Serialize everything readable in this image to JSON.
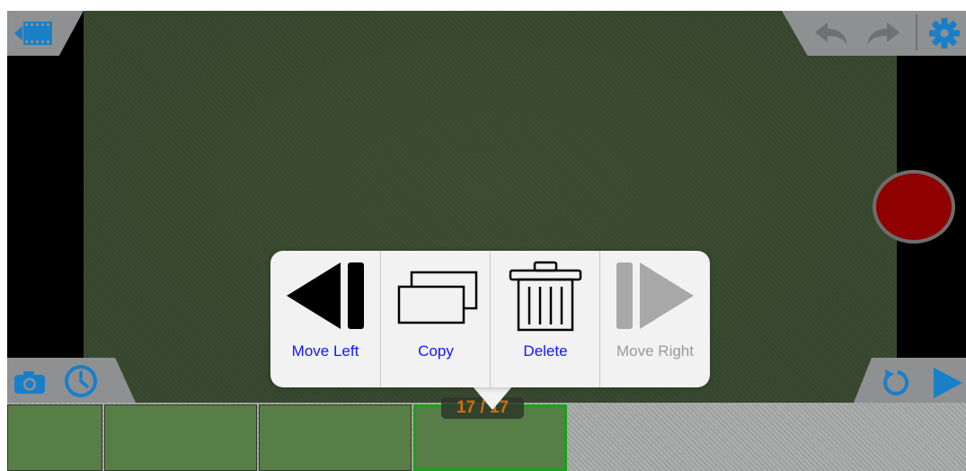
{
  "popover": {
    "actions": [
      {
        "label": "Move Left",
        "icon": "move-left-icon",
        "enabled": true
      },
      {
        "label": "Copy",
        "icon": "copy-icon",
        "enabled": true
      },
      {
        "label": "Delete",
        "icon": "trash-icon",
        "enabled": true
      },
      {
        "label": "Move Right",
        "icon": "move-right-icon",
        "enabled": false
      }
    ]
  },
  "timeline": {
    "frame_counter": "17 / 17",
    "frame_count": 4,
    "selected_frame": 4
  },
  "toolbar_icons": {
    "top_left": "film-back-icon",
    "top_right": [
      "undo-icon",
      "redo-icon",
      "gear-icon"
    ],
    "bottom_left": [
      "camera-icon",
      "timer-icon"
    ],
    "bottom_right": [
      "loop-icon",
      "play-icon"
    ]
  },
  "colors": {
    "accent": "#1a7fc9",
    "record": "#8f0000",
    "frame_selected_border": "#19a119",
    "frame_counter_text": "#d36b11",
    "action_link": "#1515ff",
    "action_disabled": "#9a9a9a"
  }
}
